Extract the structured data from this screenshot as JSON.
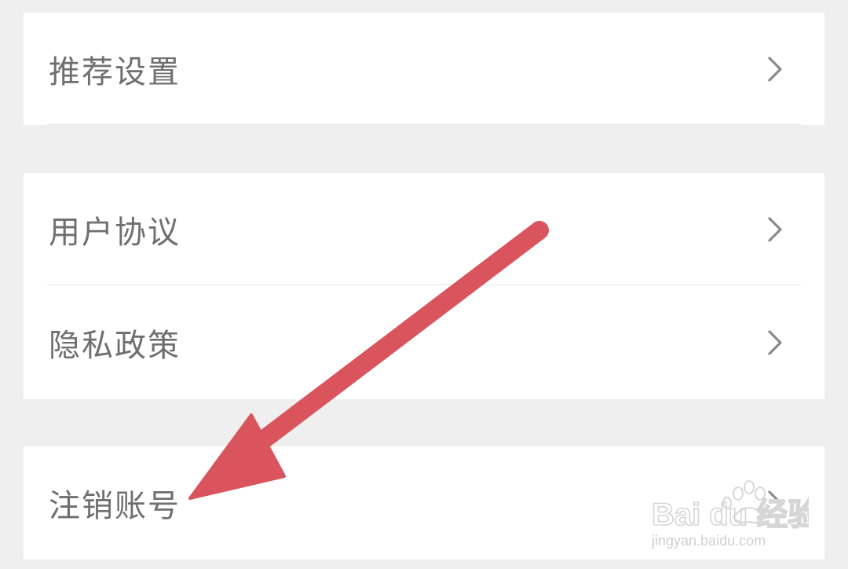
{
  "settings": {
    "group1": [
      {
        "label": "推荐设置"
      }
    ],
    "group2": [
      {
        "label": "用户协议"
      },
      {
        "label": "隐私政策"
      }
    ],
    "group3": [
      {
        "label": "注销账号"
      }
    ]
  },
  "annotation": {
    "arrow_color": "#d9545c"
  },
  "watermark": {
    "brand": "Bai du 经验",
    "url": "jingyan.baidu.com"
  },
  "colors": {
    "background": "#efefef",
    "card": "#ffffff",
    "text": "#6f6f6f",
    "chevron": "#8a8a8a"
  }
}
